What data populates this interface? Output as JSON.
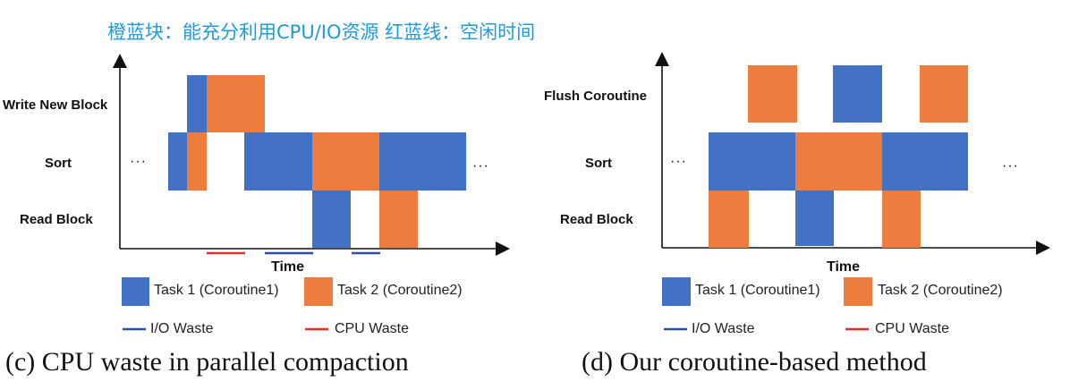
{
  "note": "橙蓝块：能充分利用CPU/IO资源  红蓝线：空闲时间",
  "colors": {
    "task1": "#4372c4",
    "task2": "#ed7d3f",
    "io_waste": "#2f4fa3",
    "cpu_waste": "#e0302a",
    "note": "#1f9bd7"
  },
  "panel_c": {
    "rows": {
      "write": "Write New Block",
      "sort": "Sort",
      "read": "Read Block"
    },
    "axis_label": "Time",
    "ellipsis_left": "···",
    "ellipsis_right": "···",
    "legend": {
      "task1": "Task 1 (Coroutine1)",
      "task2": "Task 2 (Coroutine2)",
      "io": "I/O Waste",
      "cpu": "CPU Waste"
    },
    "caption": "(c) CPU waste in parallel compaction"
  },
  "panel_d": {
    "rows": {
      "flush": "Flush Coroutine",
      "sort": "Sort",
      "read": "Read Block"
    },
    "axis_label": "Time",
    "ellipsis_left": "···",
    "ellipsis_right": "···",
    "legend": {
      "task1": "Task 1 (Coroutine1)",
      "task2": "Task 2 (Coroutine2)",
      "io": "I/O Waste",
      "cpu": "CPU Waste"
    },
    "caption": "(d) Our coroutine-based method"
  }
}
